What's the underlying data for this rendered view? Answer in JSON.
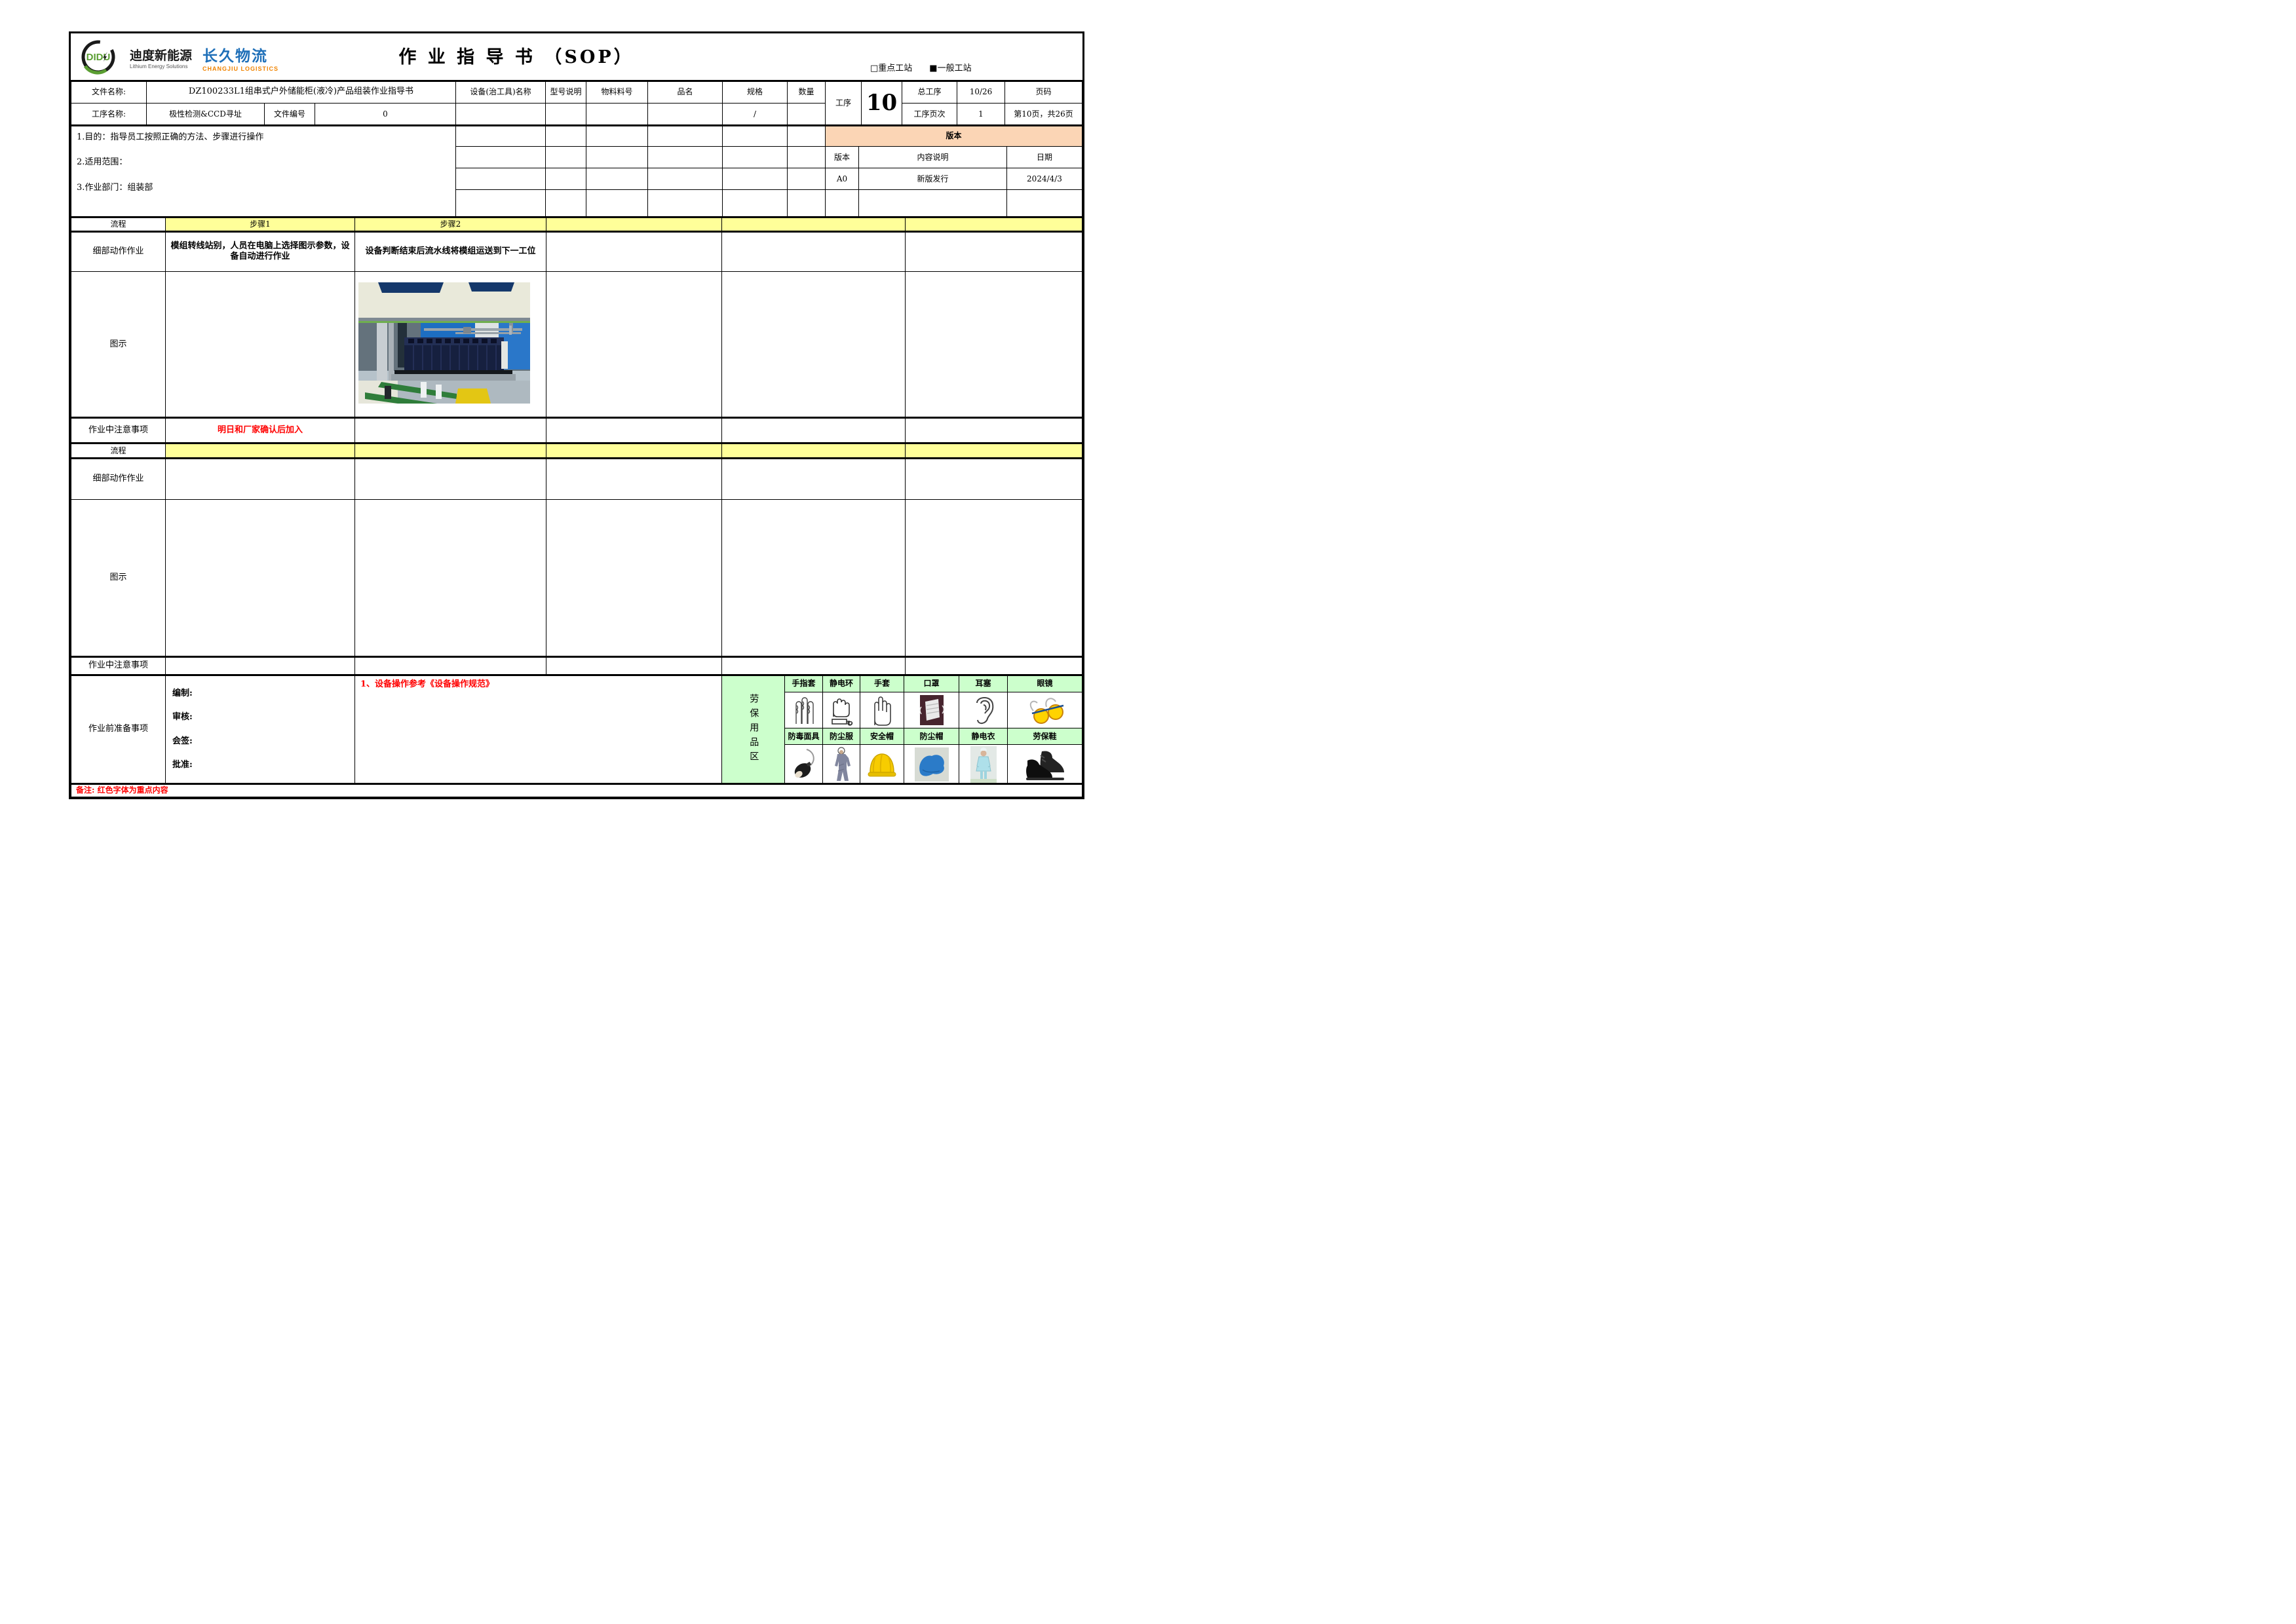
{
  "page": {
    "title": "作 业 指 导 书 （SOP）"
  },
  "logos": {
    "didu": {
      "mark": "DIDU",
      "cn": "迪度新能源",
      "en": "Lithium Energy Solutions"
    },
    "changjiu": {
      "cn": "长久物流",
      "en": "CHANGJIU LOGISTICS"
    }
  },
  "station": {
    "key": "□重点工站",
    "general": "■一般工站"
  },
  "doc": {
    "file_label": "文件名称:",
    "file_name": "DZ100233L1组串式户外储能柜(液冷)产品组装作业指导书",
    "equip_label": "设备(治工具)名称",
    "model_label": "型号说明",
    "material_label": "物料料号",
    "item_label": "品名",
    "spec_label": "规格",
    "qty_label": "数量",
    "proc_label": "工序",
    "proc_no": "10",
    "total_proc_label": "总工序",
    "total_proc": "10/26",
    "page_label": "页码",
    "step_label": "工序名称:",
    "step_name": "极性检测&CCD寻址",
    "docno_label": "文件编号",
    "docno": "0",
    "spec_value": "/",
    "proc_page_label": "工序页次",
    "proc_page": "1",
    "page_text": "第10页，共26页"
  },
  "purpose": {
    "l1": "1.目的：指导员工按照正确的方法、步骤进行操作",
    "l2": "2.适用范围：",
    "l3": "3.作业部门：组装部"
  },
  "version": {
    "banner": "版本",
    "h_version": "版本",
    "h_desc": "内容说明",
    "h_date": "日期",
    "r1_version": "A0",
    "r1_desc": "新版发行",
    "r1_date": "2024/4/3"
  },
  "labels": {
    "flow": "流程",
    "detail": "细部动作作业",
    "diagram": "图示",
    "caution": "作业中注意事项",
    "prep": "作业前准备事项"
  },
  "s1": {
    "step1": "步骤1",
    "step2": "步骤2",
    "detail1": "模组转线站别，人员在电脑上选择图示参数，设备自动进行作业",
    "detail2": "设备判断结束后流水线将模组运送到下一工位",
    "caution1": "明日和厂家确认后加入"
  },
  "prep": {
    "sign1": "编制:",
    "sign2": "审核:",
    "sign3": "会签:",
    "sign4": "批准:",
    "note": "1、设备操作参考《设备操作规范》"
  },
  "ppe": {
    "area": "劳保用品区",
    "row1": [
      "手指套",
      "静电环",
      "手套",
      "口罩",
      "耳塞",
      "眼镜"
    ],
    "row2": [
      "防毒面具",
      "防尘服",
      "安全帽",
      "防尘帽",
      "静电衣",
      "劳保鞋"
    ]
  },
  "remark": "备注: 红色字体为重点内容",
  "colors": {
    "highlight_yellow": "#FFFF99",
    "version_peach": "#FBD5B5",
    "ppe_green": "#CCFFCC",
    "accent_red": "#FF0000",
    "logo_blue": "#1E6FB8",
    "logo_orange": "#F08300",
    "logo_green": "#5A9E32"
  }
}
